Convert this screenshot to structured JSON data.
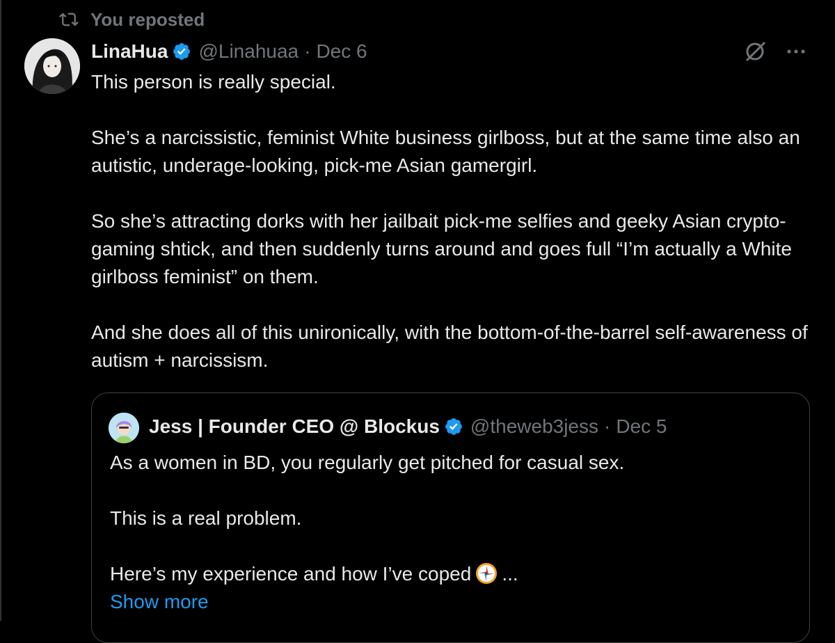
{
  "repost": {
    "label": "You reposted",
    "icon": "repost-icon"
  },
  "post": {
    "author": {
      "display_name": "LinaHua",
      "handle": "@Linahuaa",
      "verified": true,
      "avatar": "avatar-image"
    },
    "separator": "·",
    "date": "Dec 6",
    "actions": {
      "grok_icon": "grok-icon",
      "more_icon": "more-options-icon"
    },
    "paragraphs": [
      "This person is really special.",
      "She’s a narcissistic, feminist White business girlboss, but at the same time also an autistic, underage-looking, pick-me Asian gamergirl.",
      "So she’s attracting dorks with her jailbait pick-me selfies and geeky Asian crypto-gaming shtick, and then suddenly turns around and goes full “I’m actually a White girlboss feminist” on them.",
      "And she does all of this unironically, with the bottom-of-the-barrel self-awareness of autism + narcissism."
    ]
  },
  "quote": {
    "author": {
      "display_name": "Jess | Founder CEO @ Blockus",
      "handle": "@theweb3jess",
      "verified": true
    },
    "separator": "·",
    "date": "Dec 5",
    "paragraphs": [
      "As a women in BD, you regularly get pitched for casual sex.",
      "This is a real problem."
    ],
    "last_line_prefix": "Here’s my experience and how I’ve coped",
    "last_line_suffix": "...",
    "emoji": "compass-emoji",
    "show_more": "Show more"
  },
  "colors": {
    "background": "#000000",
    "text": "#e7e9ea",
    "secondary": "#71767b",
    "link": "#1d9bf0",
    "verified": "#1d9bf0",
    "border": "#3e4144"
  }
}
